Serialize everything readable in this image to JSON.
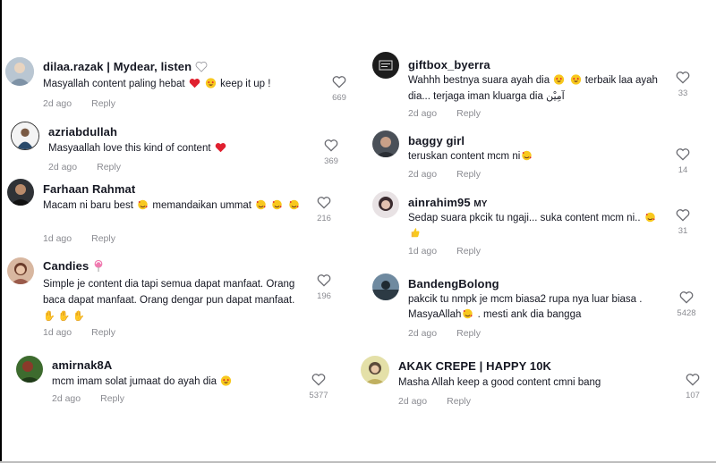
{
  "left": [
    {
      "username": "dilaa.razak | Mydear, listen",
      "text_a": "Masyallah content paling hebat",
      "text_b": "keep it up !",
      "time": "2d ago",
      "reply": "Reply",
      "likes": "669"
    },
    {
      "username": "azriabdullah",
      "text_a": "Masyaallah love this kind of content",
      "time": "2d ago",
      "reply": "Reply",
      "likes": "369"
    },
    {
      "username": "Farhaan Rahmat",
      "text_a": "Macam ni baru best",
      "text_b": "memandaikan ummat",
      "time": "1d ago",
      "reply": "Reply",
      "likes": "216"
    },
    {
      "username": "Candies",
      "text_a": "Simple je content dia tapi semua dapat manfaat. Orang baca dapat manfaat. Orang dengar pun dapat manfaat.",
      "time": "1d ago",
      "reply": "Reply",
      "likes": "196"
    },
    {
      "username": "amirnak8A",
      "text_a": "mcm imam solat jumaat do ayah dia",
      "time": "2d ago",
      "reply": "Reply",
      "likes": "5377"
    }
  ],
  "right": [
    {
      "username": "giftbox_byerra",
      "text_a": "Wahhh bestnya suara ayah dia",
      "text_b": "terbaik laa ayah dia... terjaga iman kluarga dia",
      "text_c": "آمِيْن",
      "time": "2d ago",
      "reply": "Reply",
      "likes": "33"
    },
    {
      "username": "baggy girl",
      "text_a": "teruskan content mcm ni",
      "time": "2d ago",
      "reply": "Reply",
      "likes": "14"
    },
    {
      "username": "ainrahim95",
      "badge": "MY",
      "text_a": "Sedap suara pkcik tu ngaji... suka content mcm ni..",
      "time": "1d ago",
      "reply": "Reply",
      "likes": "31"
    },
    {
      "username": "BandengBolong",
      "text_a": "pakcik tu nmpk je mcm biasa2 rupa nya luar biasa . MasyaAllah",
      "text_b": ". mesti ank dia bangga",
      "time": "2d ago",
      "reply": "Reply",
      "likes": "5428"
    },
    {
      "username": "AKAK CREPE | HAPPY 10K",
      "text_a": "Masha Allah keep a good content cmni bang",
      "time": "2d ago",
      "reply": "Reply",
      "likes": "107"
    }
  ],
  "colors": {
    "text": "#161823",
    "muted": "#8a8b91",
    "heart_red": "#e0202f",
    "outline_heart": "#6b6c72"
  },
  "icons": {
    "like": "heart-outline-icon",
    "emoji_red_heart": "red-heart-emoji",
    "emoji_heart_eyes": "heart-eyes-emoji",
    "emoji_hearts_face": "smiling-face-with-hearts-emoji",
    "emoji_lollipop": "lollipop-emoji",
    "emoji_hands": "raising-hands-emoji",
    "emoji_heart_outline": "white-heart-emoji"
  }
}
